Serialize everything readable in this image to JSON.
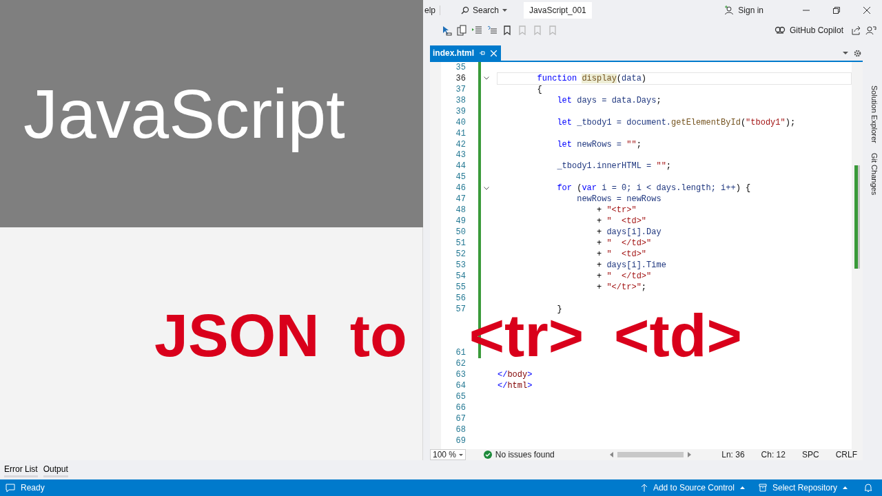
{
  "overlay": {
    "title": "JavaScript",
    "caption": [
      "JSON",
      "to",
      "<tr>",
      "<td>"
    ]
  },
  "title_bar": {
    "menu_item": "elp",
    "search": "Search",
    "solution": "JavaScript_001",
    "sign_in": "Sign in"
  },
  "toolbar": [
    {
      "kind": "select",
      "disabled": false
    },
    {
      "kind": "copy",
      "disabled": false
    },
    {
      "kind": "indent",
      "disabled": false
    },
    {
      "kind": "outdent",
      "disabled": false
    },
    {
      "kind": "bookmark",
      "disabled": false
    },
    {
      "kind": "bookmark",
      "disabled": true
    },
    {
      "kind": "bookmark",
      "disabled": true
    },
    {
      "kind": "bookmark",
      "disabled": true
    }
  ],
  "copilot": "GitHub Copilot",
  "tabs": [
    {
      "label": "index.html",
      "selected": true
    }
  ],
  "side_panels": [
    "Solution Explorer",
    "Git Changes"
  ],
  "editor": {
    "lines": [
      {
        "number": "35",
        "current": false,
        "changed": true,
        "fold": false
      },
      {
        "number": "36",
        "current": true,
        "changed": true,
        "fold": true,
        "tokens": [
          {
            "kind": "kw",
            "text": "        function "
          },
          {
            "kind": "fnhl",
            "text": "display"
          },
          {
            "kind": "plain",
            "text": "("
          },
          {
            "kind": "id",
            "text": "data"
          },
          {
            "kind": "plain",
            "text": ")"
          }
        ]
      },
      {
        "number": "37",
        "current": false,
        "changed": true,
        "fold": false,
        "tokens": [
          {
            "kind": "plain",
            "text": "        {"
          }
        ]
      },
      {
        "number": "38",
        "current": false,
        "changed": true,
        "fold": false,
        "tokens": [
          {
            "kind": "kw",
            "text": "            let"
          },
          {
            "kind": "id",
            "text": " days = data.Days"
          },
          {
            "kind": "plain",
            "text": ";"
          }
        ]
      },
      {
        "number": "39",
        "current": false,
        "changed": true,
        "fold": false
      },
      {
        "number": "40",
        "current": false,
        "changed": true,
        "fold": false,
        "tokens": [
          {
            "kind": "kw",
            "text": "            let"
          },
          {
            "kind": "id",
            "text": " _tbody1 = document."
          },
          {
            "kind": "fn",
            "text": "getElementById"
          },
          {
            "kind": "plain",
            "text": "("
          },
          {
            "kind": "str",
            "text": "\"tbody1\""
          },
          {
            "kind": "plain",
            "text": ");"
          }
        ]
      },
      {
        "number": "41",
        "current": false,
        "changed": true,
        "fold": false
      },
      {
        "number": "42",
        "current": false,
        "changed": true,
        "fold": false,
        "tokens": [
          {
            "kind": "kw",
            "text": "            let"
          },
          {
            "kind": "id",
            "text": " newRows = "
          },
          {
            "kind": "str",
            "text": "\"\""
          },
          {
            "kind": "plain",
            "text": ";"
          }
        ]
      },
      {
        "number": "43",
        "current": false,
        "changed": true,
        "fold": false
      },
      {
        "number": "44",
        "current": false,
        "changed": true,
        "fold": false,
        "tokens": [
          {
            "kind": "id",
            "text": "            _tbody1.innerHTML = "
          },
          {
            "kind": "str",
            "text": "\"\""
          },
          {
            "kind": "plain",
            "text": ";"
          }
        ]
      },
      {
        "number": "45",
        "current": false,
        "changed": true,
        "fold": false
      },
      {
        "number": "46",
        "current": false,
        "changed": true,
        "fold": true,
        "tokens": [
          {
            "kind": "kw",
            "text": "            for"
          },
          {
            "kind": "plain",
            "text": " ("
          },
          {
            "kind": "kw",
            "text": "var"
          },
          {
            "kind": "id",
            "text": " i = 0; i < days.length; i++"
          },
          {
            "kind": "plain",
            "text": ") {"
          }
        ]
      },
      {
        "number": "47",
        "current": false,
        "changed": true,
        "fold": false,
        "tokens": [
          {
            "kind": "id",
            "text": "                newRows = newRows"
          }
        ]
      },
      {
        "number": "48",
        "current": false,
        "changed": true,
        "fold": false,
        "tokens": [
          {
            "kind": "plain",
            "text": "                    + "
          },
          {
            "kind": "str",
            "text": "\"<tr>\""
          }
        ]
      },
      {
        "number": "49",
        "current": false,
        "changed": true,
        "fold": false,
        "tokens": [
          {
            "kind": "plain",
            "text": "                    + "
          },
          {
            "kind": "str",
            "text": "\"  <td>\""
          }
        ]
      },
      {
        "number": "50",
        "current": false,
        "changed": true,
        "fold": false,
        "tokens": [
          {
            "kind": "plain",
            "text": "                    + "
          },
          {
            "kind": "id",
            "text": "days[i].Day"
          }
        ]
      },
      {
        "number": "51",
        "current": false,
        "changed": true,
        "fold": false,
        "tokens": [
          {
            "kind": "plain",
            "text": "                    + "
          },
          {
            "kind": "str",
            "text": "\"  </td>\""
          }
        ]
      },
      {
        "number": "52",
        "current": false,
        "changed": true,
        "fold": false,
        "tokens": [
          {
            "kind": "plain",
            "text": "                    + "
          },
          {
            "kind": "str",
            "text": "\"  <td>\""
          }
        ]
      },
      {
        "number": "53",
        "current": false,
        "changed": true,
        "fold": false,
        "tokens": [
          {
            "kind": "plain",
            "text": "                    + "
          },
          {
            "kind": "id",
            "text": "days[i].Time"
          }
        ]
      },
      {
        "number": "54",
        "current": false,
        "changed": true,
        "fold": false,
        "tokens": [
          {
            "kind": "plain",
            "text": "                    + "
          },
          {
            "kind": "str",
            "text": "\"  </td>\""
          }
        ]
      },
      {
        "number": "55",
        "current": false,
        "changed": true,
        "fold": false,
        "tokens": [
          {
            "kind": "plain",
            "text": "                    + "
          },
          {
            "kind": "str",
            "text": "\"</tr>\""
          },
          {
            "kind": "plain",
            "text": ";"
          }
        ]
      },
      {
        "number": "56",
        "current": false,
        "changed": true,
        "fold": false
      },
      {
        "number": "57",
        "current": false,
        "changed": true,
        "fold": false,
        "tokens": [
          {
            "kind": "plain",
            "text": "            }"
          }
        ]
      },
      {
        "current": false,
        "changed": true,
        "fold": false
      },
      {
        "current": false,
        "changed": true,
        "fold": false
      },
      {
        "current": false,
        "changed": true,
        "fold": false
      },
      {
        "number": "61",
        "current": false,
        "changed": true,
        "fold": false
      },
      {
        "number": "62",
        "current": false,
        "changed": false,
        "fold": false
      },
      {
        "number": "63",
        "current": false,
        "changed": false,
        "fold": false,
        "tokens": [
          {
            "kind": "punct",
            "text": "</"
          },
          {
            "kind": "tag",
            "text": "body"
          },
          {
            "kind": "punct",
            "text": ">"
          }
        ]
      },
      {
        "number": "64",
        "current": false,
        "changed": false,
        "fold": false,
        "tokens": [
          {
            "kind": "punct",
            "text": "</"
          },
          {
            "kind": "tag",
            "text": "html"
          },
          {
            "kind": "punct",
            "text": ">"
          }
        ]
      },
      {
        "number": "65",
        "current": false,
        "changed": false,
        "fold": false
      },
      {
        "number": "66",
        "current": false,
        "changed": false,
        "fold": false
      },
      {
        "number": "67",
        "current": false,
        "changed": false,
        "fold": false
      },
      {
        "number": "68",
        "current": false,
        "changed": false,
        "fold": false
      },
      {
        "number": "69",
        "current": false,
        "changed": false,
        "fold": false
      }
    ]
  },
  "editor_status": {
    "zoom": "100 %",
    "issues": "No issues found",
    "line": "Ln: 36",
    "column": "Ch: 12",
    "spacing": "SPC",
    "line_endings": "CRLF"
  },
  "bottom_tabs": [
    "Error List",
    "Output"
  ],
  "status_bar": {
    "state": "Ready",
    "source_control": "Add to Source Control",
    "repository": "Select Repository"
  }
}
